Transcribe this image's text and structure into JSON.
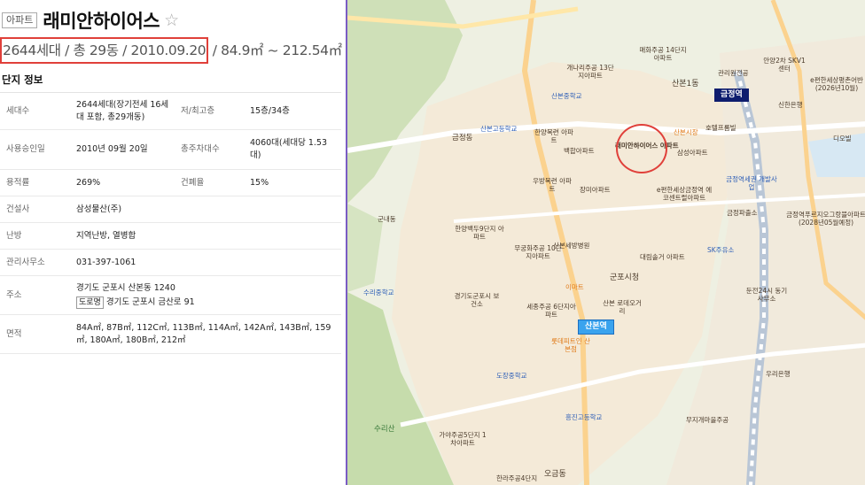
{
  "apartment": {
    "type_badge": "아파트",
    "name": "래미안하이어스",
    "star_icon": "☆",
    "summary_boxed": "2644세대 / 총 29동 / 2010.09.20",
    "summary_rest": " / 84.9㎡ ~ 212.54㎡"
  },
  "section_title": "단지 정보",
  "info": {
    "households_label": "세대수",
    "households_value": "2644세대(장기전세 16세대 포함, 총29개동)",
    "floors_label": "저/최고층",
    "floors_value": "15층/34층",
    "approval_label": "사용승인일",
    "approval_value": "2010년 09월 20일",
    "parking_label": "총주차대수",
    "parking_value": "4060대(세대당 1.53대)",
    "far_label": "용적률",
    "far_value": "269%",
    "bcr_label": "건폐율",
    "bcr_value": "15%",
    "builder_label": "건설사",
    "builder_value": "삼성물산(주)",
    "heating_label": "난방",
    "heating_value": "지역난방, 열병합",
    "office_label": "관리사무소",
    "office_value": "031-397-1061",
    "address_label": "주소",
    "address_lot": "경기도 군포시 산본동 1240",
    "address_road_tag": "도로명",
    "address_road": "경기도 군포시 금산로 91",
    "area_label": "면적",
    "area_value": "84A㎡, 87B㎡, 112C㎡, 113B㎡, 114A㎡, 142A㎡, 143B㎡, 159㎡, 180A㎡, 180B㎡, 212㎡"
  },
  "map": {
    "stations": [
      "금정역",
      "산본역"
    ],
    "labels": [
      "래미안하이어스 아파트",
      "산본1동",
      "금정동",
      "군내동",
      "산본고등학교",
      "산본중학교",
      "한양목련 아파트",
      "백합아파트",
      "우방목련 아파트",
      "장미아파트",
      "군포시청",
      "산본 로데오거리",
      "수리산",
      "세종주공 6단지아파트",
      "한양백두9단지 아파트",
      "무궁화주공 10단지아파트",
      "수리중학교",
      "경기도군포시 보건소",
      "산본세방병원",
      "롯데피트인 산본점",
      "대림솔거 아파트",
      "개나리주공 13단지아파트",
      "매화주공 14단지아파트",
      "삼성아파트",
      "호텔프롬빌",
      "금정파출소",
      "SK주유소",
      "우리은행",
      "금정역세권 개발사업",
      "이마트",
      "산본시장",
      "e편한세상금정역 에코센트럴아파트",
      "금정역푸르지오그랑블아파트 (2028년05월예정)",
      "관리원전공",
      "도장중학교",
      "흥진고등학교",
      "한라주공4단지",
      "오금동",
      "둔전24시 동기사무소",
      "무지개마을주공",
      "가야주공5단지 1차아파트",
      "디오빌",
      "안양2차 SKV1센터",
      "e편한세상평촌어반 (2026년10월)",
      "신한은행"
    ]
  }
}
